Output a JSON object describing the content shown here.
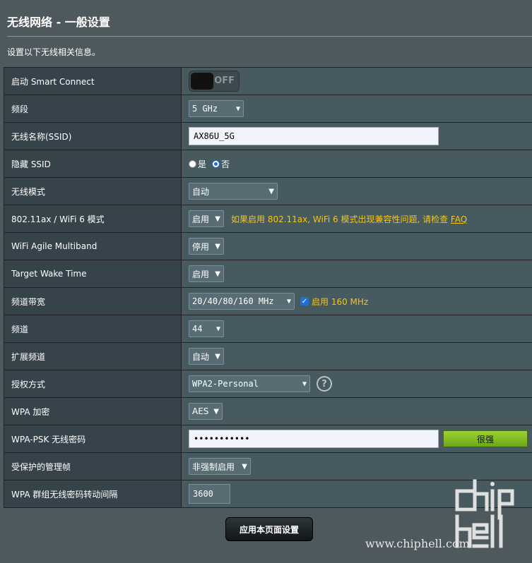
{
  "header": {
    "title": "无线网络 - 一般设置",
    "subtitle": "设置以下无线相关信息。"
  },
  "rows": {
    "smart_connect": {
      "label": "启动 Smart Connect",
      "toggle": "OFF"
    },
    "band": {
      "label": "频段",
      "value": "5 GHz"
    },
    "ssid": {
      "label": "无线名称(SSID)",
      "value": "AX86U_5G"
    },
    "hide_ssid": {
      "label": "隐藏 SSID",
      "yes": "是",
      "no": "否",
      "selected": "否"
    },
    "wireless_mode": {
      "label": "无线模式",
      "value": "自动"
    },
    "wifi6": {
      "label": "802.11ax / WiFi 6 模式",
      "value": "启用",
      "note": "如果启用 802.11ax, WiFi 6 模式出现兼容性问题, 请检查",
      "link": "FAQ"
    },
    "agile": {
      "label": "WiFi Agile Multiband",
      "value": "停用"
    },
    "twt": {
      "label": "Target Wake Time",
      "value": "启用"
    },
    "bandwidth": {
      "label": "频道带宽",
      "value": "20/40/80/160 MHz",
      "checkbox_label": "启用 160 MHz",
      "checked": true
    },
    "channel": {
      "label": "频道",
      "value": "44"
    },
    "ext_channel": {
      "label": "扩展频道",
      "value": "自动"
    },
    "auth": {
      "label": "授权方式",
      "value": "WPA2-Personal"
    },
    "wpa_enc": {
      "label": "WPA 加密",
      "value": "AES"
    },
    "psk": {
      "label": "WPA-PSK 无线密码",
      "value": "•••••••••••",
      "strength": "很强"
    },
    "pmf": {
      "label": "受保护的管理帧",
      "value": "非强制启用"
    },
    "rekey": {
      "label": "WPA 群组无线密码转动间隔",
      "value": "3600"
    }
  },
  "apply_button": "应用本页面设置",
  "watermark": {
    "logo": "chiphell",
    "url": "www.chiphell.com"
  },
  "colors": {
    "page_bg": "#4d595d",
    "label_bg": "#36434a",
    "value_bg": "#475a5f",
    "note": "#f5c518",
    "strength": "#8cc63f"
  }
}
